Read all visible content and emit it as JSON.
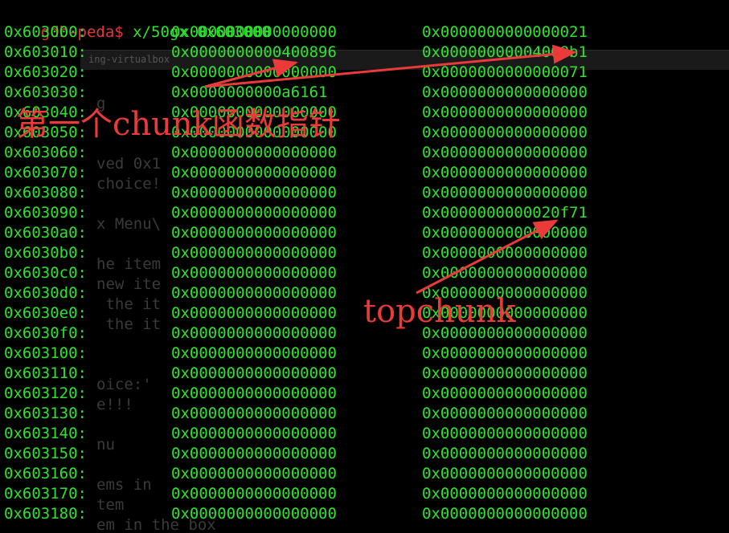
{
  "prompt": "gdb-peda$",
  "command": "x/50gx 0x603000",
  "rows": [
    [
      "0x603000:",
      "0x0000000000000000",
      "0x0000000000000021"
    ],
    [
      "0x603010:",
      "0x0000000000400896",
      "0x00000000004008b1"
    ],
    [
      "0x603020:",
      "0x0000000000000000",
      "0x0000000000000071"
    ],
    [
      "0x603030:",
      "0x0000000000a6161",
      "0x0000000000000000"
    ],
    [
      "0x603040:",
      "0x0000000000000000",
      "0x0000000000000000"
    ],
    [
      "0x603050:",
      "0x0000000000000000",
      "0x0000000000000000"
    ],
    [
      "0x603060:",
      "0x0000000000000000",
      "0x0000000000000000"
    ],
    [
      "0x603070:",
      "0x0000000000000000",
      "0x0000000000000000"
    ],
    [
      "0x603080:",
      "0x0000000000000000",
      "0x0000000000000000"
    ],
    [
      "0x603090:",
      "0x0000000000000000",
      "0x0000000000020f71"
    ],
    [
      "0x6030a0:",
      "0x0000000000000000",
      "0x0000000000000000"
    ],
    [
      "0x6030b0:",
      "0x0000000000000000",
      "0x0000000000000000"
    ],
    [
      "0x6030c0:",
      "0x0000000000000000",
      "0x0000000000000000"
    ],
    [
      "0x6030d0:",
      "0x0000000000000000",
      "0x0000000000000000"
    ],
    [
      "0x6030e0:",
      "0x0000000000000000",
      "0x0000000000000000"
    ],
    [
      "0x6030f0:",
      "0x0000000000000000",
      "0x0000000000000000"
    ],
    [
      "0x603100:",
      "0x0000000000000000",
      "0x0000000000000000"
    ],
    [
      "0x603110:",
      "0x0000000000000000",
      "0x0000000000000000"
    ],
    [
      "0x603120:",
      "0x0000000000000000",
      "0x0000000000000000"
    ],
    [
      "0x603130:",
      "0x0000000000000000",
      "0x0000000000000000"
    ],
    [
      "0x603140:",
      "0x0000000000000000",
      "0x0000000000000000"
    ],
    [
      "0x603150:",
      "0x0000000000000000",
      "0x0000000000000000"
    ],
    [
      "0x603160:",
      "0x0000000000000000",
      "0x0000000000000000"
    ],
    [
      "0x603170:",
      "0x0000000000000000",
      "0x0000000000000000"
    ],
    [
      "0x603180:",
      "0x0000000000000000",
      "0x0000000000000000"
    ]
  ],
  "annotations": {
    "first_chunk_label": "第一个chunk函数指针",
    "topchunk_label": "topchunk"
  },
  "ghost_text": {
    "tab_title": "ing-virtualbox",
    "lines": [
      "g",
      "ved 0x1",
      "choice!",
      "x Menu\\",
      "he item",
      "new ite",
      " the it",
      " the it",
      "oice:'",
      "e!!!",
      "nu",
      "ems in",
      "tem",
      "em in the box"
    ]
  },
  "colors": {
    "background": "#000000",
    "text": "#2ee22e",
    "prompt": "#e0363a",
    "annotation": "#ea3a3a"
  },
  "icons": {
    "cursor": "block-cursor-icon",
    "arrows": "arrow-icon"
  }
}
